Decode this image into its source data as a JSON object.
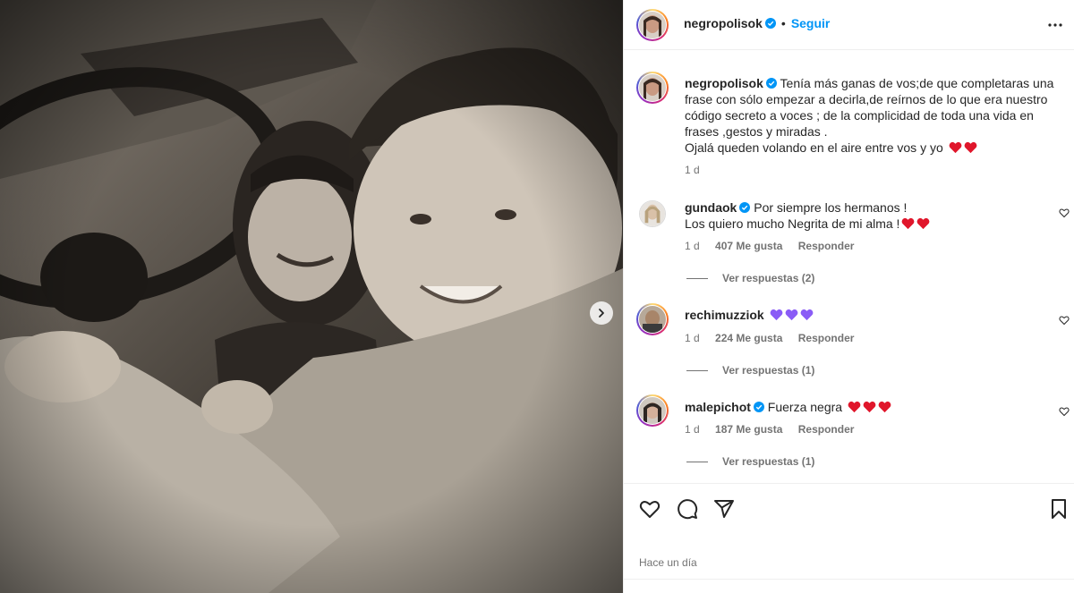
{
  "post": {
    "author": "negropolisok",
    "follow_label": "Seguir",
    "separator": "•",
    "more_label": "Más opciones"
  },
  "caption": {
    "username": "negropolisok",
    "text": "Tenía más ganas de vos;de que completaras una frase con sólo empezar a decirla,de reírnos de lo que era nuestro código secreto a voces ; de la complicidad de toda una vida en frases ,gestos y miradas .",
    "text2": "Ojalá queden volando en el aire entre vos y yo",
    "time": "1 d"
  },
  "comments": [
    {
      "username": "gundaok",
      "text": "Por siempre los hermanos !",
      "text2": "Los quiero mucho Negrita de mi alma !",
      "time": "1 d",
      "likes": "407 Me gusta",
      "reply": "Responder",
      "view_replies": "Ver respuestas (2)"
    },
    {
      "username": "rechimuzziok",
      "text": "",
      "time": "1 d",
      "likes": "224 Me gusta",
      "reply": "Responder",
      "view_replies": "Ver respuestas (1)"
    },
    {
      "username": "malepichot",
      "text": "Fuerza negra",
      "time": "1 d",
      "likes": "187 Me gusta",
      "reply": "Responder",
      "view_replies": "Ver respuestas (1)"
    }
  ],
  "footer": {
    "date": "Hace un día"
  },
  "colors": {
    "accent": "#0095f6",
    "verified": "#0095f6",
    "heart_red": "#e0162b",
    "heart_purple": "#8a5cf6",
    "muted": "#737373"
  },
  "icons": [
    "more-horizontal-icon",
    "verified-icon",
    "heart-icon",
    "comment-icon",
    "share-icon",
    "bookmark-icon",
    "chevron-right-icon"
  ]
}
